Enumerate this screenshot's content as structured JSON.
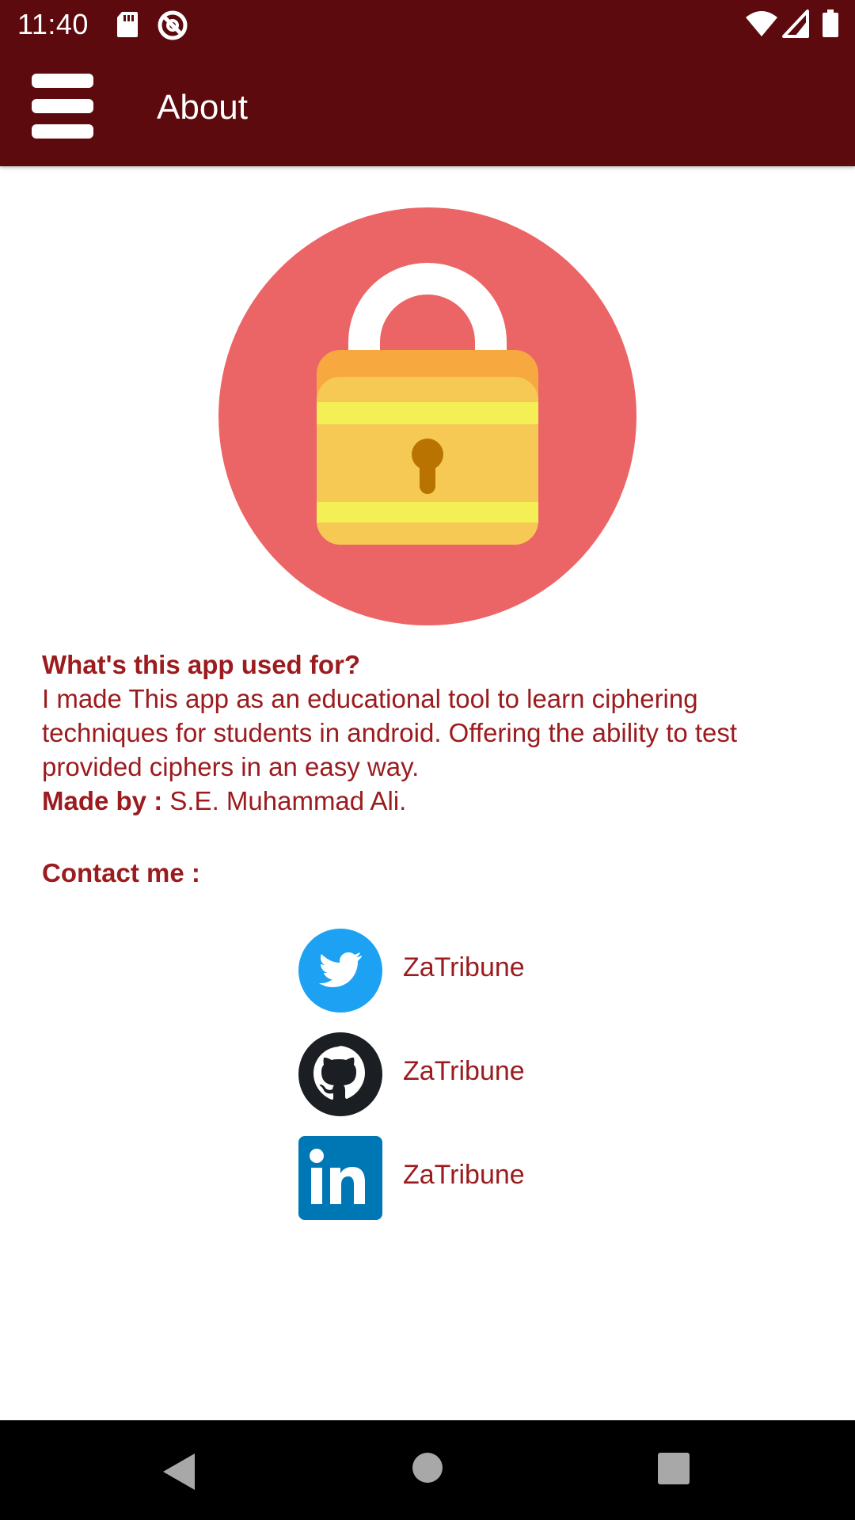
{
  "status_bar": {
    "time": "11:40",
    "icons": [
      "sd-card-icon",
      "notification-icon",
      "wifi-icon",
      "signal-icon",
      "battery-icon"
    ]
  },
  "app_bar": {
    "title": "About",
    "menu_icon": "hamburger-menu-icon"
  },
  "hero": {
    "icon": "padlock-icon"
  },
  "about": {
    "heading": "What's this app used for?",
    "description": "I made This app as an educational tool to learn ciphering techniques for students in android. Offering the ability to test provided ciphers in an easy way.",
    "made_by_label": "Made by :",
    "made_by_value": "S.E. Muhammad Ali."
  },
  "contact": {
    "heading": "Contact me :",
    "items": [
      {
        "icon": "twitter-icon",
        "label": "ZaTribune"
      },
      {
        "icon": "github-icon",
        "label": "ZaTribune"
      },
      {
        "icon": "linkedin-icon",
        "label": "ZaTribune"
      }
    ]
  },
  "nav_bar": {
    "buttons": [
      "back-icon",
      "home-icon",
      "recents-icon"
    ]
  },
  "colors": {
    "primary_dark": "#5d0a0e",
    "text_accent": "#9b1b1e",
    "hero_circle": "#ec6566",
    "twitter": "#1da1f2",
    "github": "#1b1f23",
    "linkedin": "#0077b5"
  }
}
